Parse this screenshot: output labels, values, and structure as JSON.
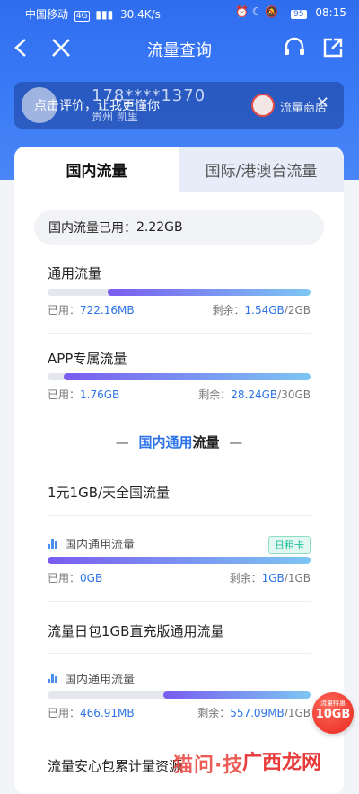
{
  "status_bar": {
    "carrier": "中国移动",
    "network": "4G",
    "speed": "30.4K/s",
    "battery": "95",
    "time": "08:15"
  },
  "nav": {
    "title": "流量查询",
    "back_icon": "back-arrow-icon",
    "close_icon": "close-icon",
    "support_icon": "headset-icon",
    "share_icon": "share-icon"
  },
  "user": {
    "phone": "178****1370",
    "location": "贵州 凯里",
    "overlay_prompt": "点击评价，让我更懂你",
    "shop_label": "流量商店"
  },
  "tabs": [
    {
      "label": "国内流量",
      "active": true
    },
    {
      "label": "国际/港澳台流量",
      "active": false
    }
  ],
  "summary": {
    "label": "国内流量已用：",
    "value": "2.22GB"
  },
  "general": {
    "title": "通用流量",
    "used_label": "已用：",
    "used_value": "722.16MB",
    "remain_label": "剩余：",
    "remain_value": "1.54GB",
    "total": "/2GB",
    "remaining_fraction": 0.77
  },
  "app_specific": {
    "title": "APP专属流量",
    "used_label": "已用：",
    "used_value": "1.76GB",
    "remain_label": "剩余：",
    "remain_value": "28.24GB",
    "total": "/30GB",
    "remaining_fraction": 0.94
  },
  "section_header": {
    "dash_left": "—",
    "highlight": "国内通用",
    "rest": "流量",
    "dash_right": "—"
  },
  "packages": [
    {
      "title": "1元1GB/天全国流量",
      "type_label": "国内通用流量",
      "tag": "日租卡",
      "used_label": "已用：",
      "used_value": "0GB",
      "remain_label": "剩余：",
      "remain_value": "1GB",
      "total": "/1GB",
      "remaining_fraction": 1.0
    },
    {
      "title": "流量日包1GB直充版通用流量",
      "type_label": "国内通用流量",
      "used_label": "已用：",
      "used_value": "466.91MB",
      "remain_label": "剩余：",
      "remain_value": "557.09MB",
      "total": "/1GB",
      "remaining_fraction": 0.56
    }
  ],
  "next_title": "流量安心包累计量资源",
  "floating_badge": {
    "small": "流量特惠",
    "big": "10GB"
  },
  "watermark": {
    "text1": "猫问·技",
    "text2": "广西龙网"
  }
}
